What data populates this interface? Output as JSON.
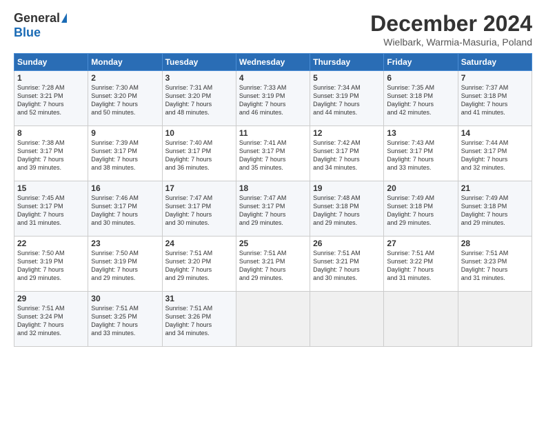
{
  "logo": {
    "general": "General",
    "blue": "Blue"
  },
  "title": "December 2024",
  "subtitle": "Wielbark, Warmia-Masuria, Poland",
  "days_header": [
    "Sunday",
    "Monday",
    "Tuesday",
    "Wednesday",
    "Thursday",
    "Friday",
    "Saturday"
  ],
  "weeks": [
    [
      {
        "day": "1",
        "lines": [
          "Sunrise: 7:28 AM",
          "Sunset: 3:21 PM",
          "Daylight: 7 hours",
          "and 52 minutes."
        ]
      },
      {
        "day": "2",
        "lines": [
          "Sunrise: 7:30 AM",
          "Sunset: 3:20 PM",
          "Daylight: 7 hours",
          "and 50 minutes."
        ]
      },
      {
        "day": "3",
        "lines": [
          "Sunrise: 7:31 AM",
          "Sunset: 3:20 PM",
          "Daylight: 7 hours",
          "and 48 minutes."
        ]
      },
      {
        "day": "4",
        "lines": [
          "Sunrise: 7:33 AM",
          "Sunset: 3:19 PM",
          "Daylight: 7 hours",
          "and 46 minutes."
        ]
      },
      {
        "day": "5",
        "lines": [
          "Sunrise: 7:34 AM",
          "Sunset: 3:19 PM",
          "Daylight: 7 hours",
          "and 44 minutes."
        ]
      },
      {
        "day": "6",
        "lines": [
          "Sunrise: 7:35 AM",
          "Sunset: 3:18 PM",
          "Daylight: 7 hours",
          "and 42 minutes."
        ]
      },
      {
        "day": "7",
        "lines": [
          "Sunrise: 7:37 AM",
          "Sunset: 3:18 PM",
          "Daylight: 7 hours",
          "and 41 minutes."
        ]
      }
    ],
    [
      {
        "day": "8",
        "lines": [
          "Sunrise: 7:38 AM",
          "Sunset: 3:17 PM",
          "Daylight: 7 hours",
          "and 39 minutes."
        ]
      },
      {
        "day": "9",
        "lines": [
          "Sunrise: 7:39 AM",
          "Sunset: 3:17 PM",
          "Daylight: 7 hours",
          "and 38 minutes."
        ]
      },
      {
        "day": "10",
        "lines": [
          "Sunrise: 7:40 AM",
          "Sunset: 3:17 PM",
          "Daylight: 7 hours",
          "and 36 minutes."
        ]
      },
      {
        "day": "11",
        "lines": [
          "Sunrise: 7:41 AM",
          "Sunset: 3:17 PM",
          "Daylight: 7 hours",
          "and 35 minutes."
        ]
      },
      {
        "day": "12",
        "lines": [
          "Sunrise: 7:42 AM",
          "Sunset: 3:17 PM",
          "Daylight: 7 hours",
          "and 34 minutes."
        ]
      },
      {
        "day": "13",
        "lines": [
          "Sunrise: 7:43 AM",
          "Sunset: 3:17 PM",
          "Daylight: 7 hours",
          "and 33 minutes."
        ]
      },
      {
        "day": "14",
        "lines": [
          "Sunrise: 7:44 AM",
          "Sunset: 3:17 PM",
          "Daylight: 7 hours",
          "and 32 minutes."
        ]
      }
    ],
    [
      {
        "day": "15",
        "lines": [
          "Sunrise: 7:45 AM",
          "Sunset: 3:17 PM",
          "Daylight: 7 hours",
          "and 31 minutes."
        ]
      },
      {
        "day": "16",
        "lines": [
          "Sunrise: 7:46 AM",
          "Sunset: 3:17 PM",
          "Daylight: 7 hours",
          "and 30 minutes."
        ]
      },
      {
        "day": "17",
        "lines": [
          "Sunrise: 7:47 AM",
          "Sunset: 3:17 PM",
          "Daylight: 7 hours",
          "and 30 minutes."
        ]
      },
      {
        "day": "18",
        "lines": [
          "Sunrise: 7:47 AM",
          "Sunset: 3:17 PM",
          "Daylight: 7 hours",
          "and 29 minutes."
        ]
      },
      {
        "day": "19",
        "lines": [
          "Sunrise: 7:48 AM",
          "Sunset: 3:18 PM",
          "Daylight: 7 hours",
          "and 29 minutes."
        ]
      },
      {
        "day": "20",
        "lines": [
          "Sunrise: 7:49 AM",
          "Sunset: 3:18 PM",
          "Daylight: 7 hours",
          "and 29 minutes."
        ]
      },
      {
        "day": "21",
        "lines": [
          "Sunrise: 7:49 AM",
          "Sunset: 3:18 PM",
          "Daylight: 7 hours",
          "and 29 minutes."
        ]
      }
    ],
    [
      {
        "day": "22",
        "lines": [
          "Sunrise: 7:50 AM",
          "Sunset: 3:19 PM",
          "Daylight: 7 hours",
          "and 29 minutes."
        ]
      },
      {
        "day": "23",
        "lines": [
          "Sunrise: 7:50 AM",
          "Sunset: 3:19 PM",
          "Daylight: 7 hours",
          "and 29 minutes."
        ]
      },
      {
        "day": "24",
        "lines": [
          "Sunrise: 7:51 AM",
          "Sunset: 3:20 PM",
          "Daylight: 7 hours",
          "and 29 minutes."
        ]
      },
      {
        "day": "25",
        "lines": [
          "Sunrise: 7:51 AM",
          "Sunset: 3:21 PM",
          "Daylight: 7 hours",
          "and 29 minutes."
        ]
      },
      {
        "day": "26",
        "lines": [
          "Sunrise: 7:51 AM",
          "Sunset: 3:21 PM",
          "Daylight: 7 hours",
          "and 30 minutes."
        ]
      },
      {
        "day": "27",
        "lines": [
          "Sunrise: 7:51 AM",
          "Sunset: 3:22 PM",
          "Daylight: 7 hours",
          "and 31 minutes."
        ]
      },
      {
        "day": "28",
        "lines": [
          "Sunrise: 7:51 AM",
          "Sunset: 3:23 PM",
          "Daylight: 7 hours",
          "and 31 minutes."
        ]
      }
    ],
    [
      {
        "day": "29",
        "lines": [
          "Sunrise: 7:51 AM",
          "Sunset: 3:24 PM",
          "Daylight: 7 hours",
          "and 32 minutes."
        ]
      },
      {
        "day": "30",
        "lines": [
          "Sunrise: 7:51 AM",
          "Sunset: 3:25 PM",
          "Daylight: 7 hours",
          "and 33 minutes."
        ]
      },
      {
        "day": "31",
        "lines": [
          "Sunrise: 7:51 AM",
          "Sunset: 3:26 PM",
          "Daylight: 7 hours",
          "and 34 minutes."
        ]
      },
      null,
      null,
      null,
      null
    ]
  ]
}
